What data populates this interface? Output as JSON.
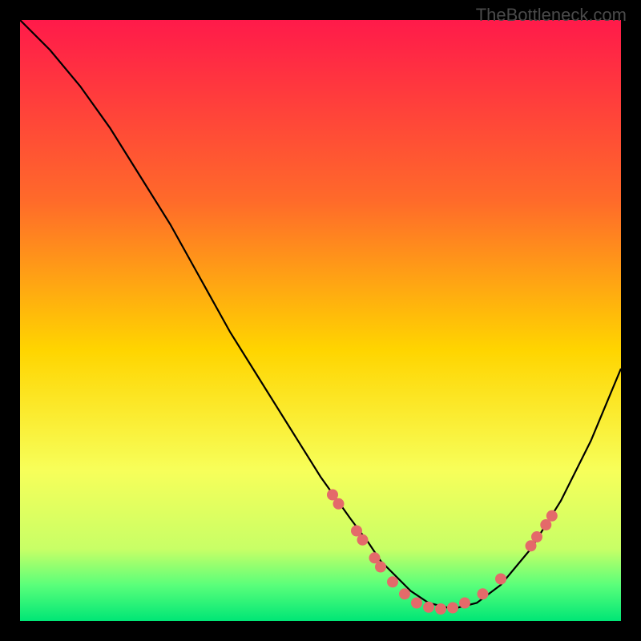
{
  "watermark": "TheBottleneck.com",
  "chart_data": {
    "type": "line",
    "title": "",
    "xlabel": "",
    "ylabel": "",
    "xlim": [
      0,
      100
    ],
    "ylim": [
      0,
      100
    ],
    "gradient_stops": [
      {
        "offset": 0,
        "color": "#ff1a4a"
      },
      {
        "offset": 30,
        "color": "#ff6a2a"
      },
      {
        "offset": 55,
        "color": "#ffd500"
      },
      {
        "offset": 75,
        "color": "#f7ff5a"
      },
      {
        "offset": 88,
        "color": "#c8ff66"
      },
      {
        "offset": 94,
        "color": "#5aff7a"
      },
      {
        "offset": 100,
        "color": "#00e676"
      }
    ],
    "series": [
      {
        "name": "bottleneck-curve",
        "x": [
          0,
          5,
          10,
          15,
          20,
          25,
          30,
          35,
          40,
          45,
          50,
          55,
          58,
          60,
          62,
          65,
          68,
          72,
          76,
          80,
          85,
          90,
          95,
          100
        ],
        "y": [
          100,
          95,
          89,
          82,
          74,
          66,
          57,
          48,
          40,
          32,
          24,
          17,
          13,
          10,
          8,
          5,
          3,
          2,
          3,
          6,
          12,
          20,
          30,
          42
        ]
      }
    ],
    "markers": {
      "name": "highlighted-points",
      "color": "#e46a6a",
      "radius": 7,
      "points": [
        {
          "x": 52,
          "y": 21
        },
        {
          "x": 53,
          "y": 19.5
        },
        {
          "x": 56,
          "y": 15
        },
        {
          "x": 57,
          "y": 13.5
        },
        {
          "x": 59,
          "y": 10.5
        },
        {
          "x": 60,
          "y": 9
        },
        {
          "x": 62,
          "y": 6.5
        },
        {
          "x": 64,
          "y": 4.5
        },
        {
          "x": 66,
          "y": 3
        },
        {
          "x": 68,
          "y": 2.3
        },
        {
          "x": 70,
          "y": 2
        },
        {
          "x": 72,
          "y": 2.2
        },
        {
          "x": 74,
          "y": 3
        },
        {
          "x": 77,
          "y": 4.5
        },
        {
          "x": 80,
          "y": 7
        },
        {
          "x": 85,
          "y": 12.5
        },
        {
          "x": 86,
          "y": 14
        },
        {
          "x": 87.5,
          "y": 16
        },
        {
          "x": 88.5,
          "y": 17.5
        }
      ]
    }
  }
}
